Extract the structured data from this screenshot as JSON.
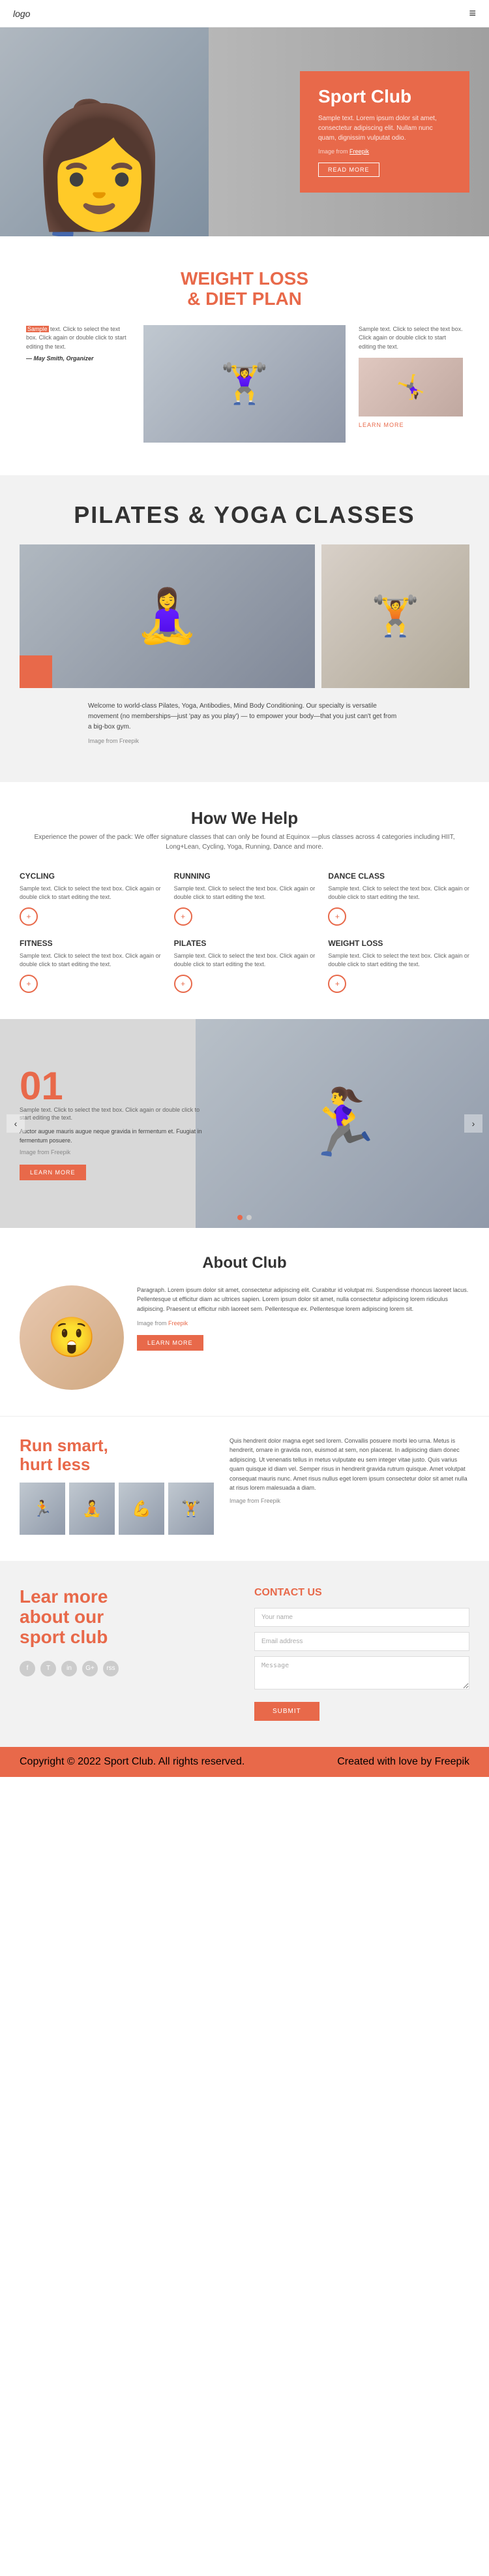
{
  "header": {
    "logo": "logo",
    "menu_icon": "≡"
  },
  "hero": {
    "title_line1": "Sport Club",
    "description": "Sample text. Lorem ipsum dolor sit amet, consectetur adipiscing elit. Nullam nunc quam, dignissim vulputat odio.",
    "image_credit_text": "Image from",
    "image_credit_link": "Freepik",
    "read_more": "READ MORE"
  },
  "weight_loss": {
    "title_line1": "WEIGHT LOSS",
    "title_line2": "& DIET PLAN",
    "quote_highlight": "Sample",
    "quote_text": " text. Click to select the text box. Click again or double click to start editing the text.",
    "author": "— May Smith, Organizer",
    "sample_text": "Sample text. Click to select the text box. Click again or double click to start editing the text.",
    "learn_more": "LEARN MORE"
  },
  "pilates": {
    "title": "PILATES & YOGA CLASSES",
    "description": "Welcome to world-class Pilates, Yoga, Antibodies, Mind Body Conditioning. Our specialty is versatile movement (no memberships—just 'pay as you play') — to empower your body—that you just can't get from a big-box gym.",
    "image_credit": "Image from Freepik"
  },
  "how_help": {
    "title": "How We Help",
    "subtitle": "Experience the power of the pack: We offer signature classes that can only be found at Equinox —plus classes across 4 categories including HIIT, Long+Lean, Cycling, Yoga, Running, Dance and more.",
    "items": [
      {
        "title": "CYCLING",
        "text": "Sample text. Click to select the text box. Click again or double click to start editing the text.",
        "icon": "+"
      },
      {
        "title": "RUNNING",
        "text": "Sample text. Click to select the text box. Click again or double click to start editing the text.",
        "icon": "+"
      },
      {
        "title": "DANCE CLASS",
        "text": "Sample text. Click to select the text box. Click again or double click to start editing the text.",
        "icon": "+"
      },
      {
        "title": "FITNESS",
        "text": "Sample text. Click to select the text box. Click again or double click to start editing the text.",
        "icon": "+"
      },
      {
        "title": "PILATES",
        "text": "Sample text. Click to select the text box. Click again or double click to start editing the text.",
        "icon": "+"
      },
      {
        "title": "WEIGHT LOSS",
        "text": "Sample text. Click to select the text box. Click again or double click to start editing the text.",
        "icon": "+"
      }
    ]
  },
  "carousel": {
    "number": "01",
    "sample_text": "Sample text. Click to select the text box. Click again or double click to start editing the text.",
    "main_text": "Auctor augue mauris augue neque gravida in fermentum et. Fuugiat in fermentum posuere.",
    "image_credit": "Image from Freepik",
    "learn_more": "LEARN MORE",
    "prev_arrow": "‹",
    "next_arrow": "›",
    "dots": [
      true,
      false
    ]
  },
  "about": {
    "title": "About Club",
    "text": "Paragraph. Lorem ipsum dolor sit amet, consectetur adipiscing elit. Curabitur id volutpat mi. Suspendisse rhoncus laoreet lacus. Pellentesque ut efficitur diam ac ultrices sapien. Lorem ipsum dolor sit amet, nulla consectetur adipiscing lorem ridiculus adipiscing. Praesent ut efficitur nibh laoreet sem. Pellentesque ex. Pellentesque lorem adipiscing lorem sit.",
    "image_credit_prefix": "Image from",
    "image_credit_link": "Freepik",
    "learn_more": "LEARN MORE"
  },
  "run_smart": {
    "title_line1": "Run smart,",
    "title_line2": "hurt less",
    "text": "Quis hendrerit dolor magna eget sed lorem. Convallis posuere morbi leo urna. Metus is hendrerit, ornare in gravida non, euismod at sem, non placerat. In adipiscing diam donec adipiscing. Ut venenatis tellus in metus vulputate eu sem integer vitae justo. Quis varius quam quisque id diam vel. Semper risus in hendrerit gravida rutrum quisque. Amet volutpat consequat mauris nunc. Amet risus nullus eget lorem ipsum consectetur dolor sit amet nulla at risus lorem malesuada a diam.",
    "image_credit": "Image from Freepik",
    "photos": [
      "🏃",
      "🧘",
      "💪",
      "🏋"
    ]
  },
  "footer": {
    "left_title_line1": "Lear more",
    "left_title_line2": "about our",
    "left_title_line3": "sport club",
    "social_icons": [
      "f",
      "T",
      "in",
      "G+",
      "rss"
    ],
    "contact_title": "CONTACT US",
    "form": {
      "name_placeholder": "Your name",
      "email_placeholder": "Email address",
      "message_placeholder": "Message",
      "submit_label": "SUBMIT"
    }
  },
  "footer_bottom": {
    "copyright": "Copyright © 2022 Sport Club. All rights reserved.",
    "credits": "Created with love by Freepik"
  }
}
